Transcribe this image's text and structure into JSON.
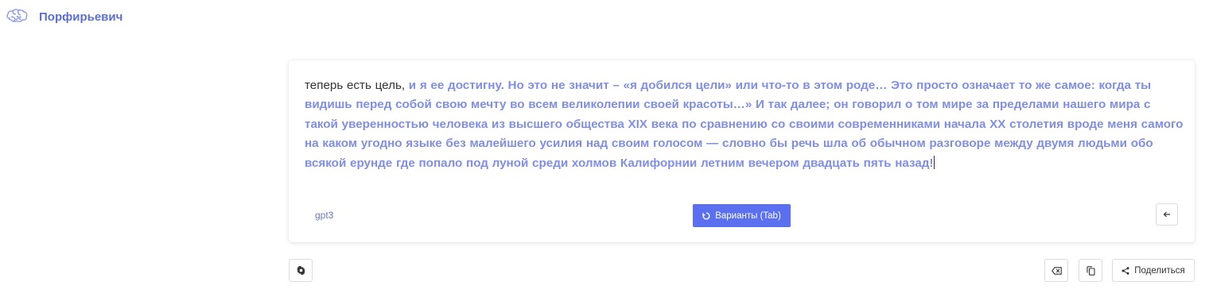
{
  "app": {
    "brand": "Порфирьевич"
  },
  "editor": {
    "user_text": "теперь есть цель,",
    "generated_text": " и я ее достигну. Но это не значит – «я добился цели» или что-то в этом роде… Это просто означает то же самое: когда ты видишь перед собой свою мечту во всем великолепии своей красоты…» И так далее; он говорил о том мире за пределами нашего мира с такой уверенностью человека из высшего общества XIX века по сравнению со своими современниками начала XX столетия вроде меня самого на каком угодно языке без малейшего усилия над своим голосом — словно бы речь шла об обычном разговоре между двумя людьми обо всякой ерунде где попало под луной среди холмов Калифорнии летним вечером двадцать пять назад!",
    "model": "gpt3",
    "variants_label": "Варианты (Tab)",
    "back_icon": "arrow-left-icon"
  },
  "toolbar": {
    "settings_icon": "gear-icon",
    "clear_icon": "backspace-icon",
    "copy_icon": "copy-icon",
    "share_label": "Поделиться",
    "share_icon": "share-icon"
  },
  "colors": {
    "accent": "#5a70f0",
    "brand": "#5b6fd6",
    "generated_text": "#7f8ee8"
  }
}
